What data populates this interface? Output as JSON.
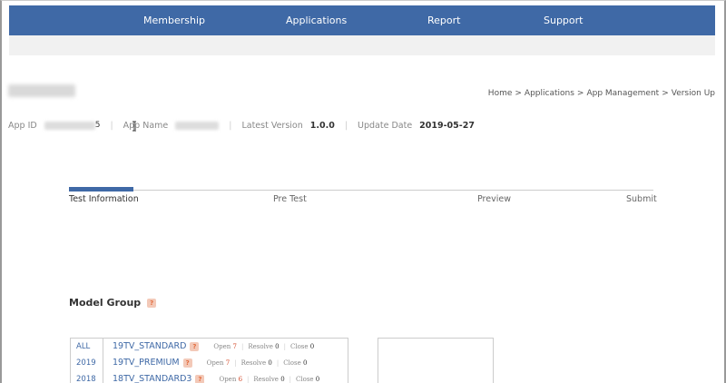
{
  "nav": {
    "items": [
      "Membership",
      "Applications",
      "Report",
      "Support"
    ]
  },
  "breadcrumb": {
    "items": [
      "Home",
      "Applications",
      "App Management",
      "Version Up"
    ],
    "separator": ">"
  },
  "info": {
    "app_id_label": "App ID",
    "app_id_suffix": "5",
    "app_name_label": "App Name",
    "latest_version_label": "Latest Version",
    "latest_version_value": "1.0.0",
    "update_date_label": "Update Date",
    "update_date_value": "2019-05-27",
    "divider": "|"
  },
  "steps": {
    "items": [
      "Test Information",
      "Pre Test",
      "Preview",
      "Submit"
    ],
    "active_index": 0
  },
  "model_group": {
    "title": "Model Group",
    "help": "?",
    "years": [
      "ALL",
      "2019",
      "2018"
    ],
    "rows": [
      {
        "name": "19TV_STANDARD",
        "open_label": "Open",
        "open": "7",
        "resolve_label": "Resolve",
        "resolve": "0",
        "close_label": "Close",
        "close": "0"
      },
      {
        "name": "19TV_PREMIUM",
        "open_label": "Open",
        "open": "7",
        "resolve_label": "Resolve",
        "resolve": "0",
        "close_label": "Close",
        "close": "0"
      },
      {
        "name": "18TV_STANDARD3",
        "open_label": "Open",
        "open": "6",
        "resolve_label": "Resolve",
        "resolve": "0",
        "close_label": "Close",
        "close": "0"
      }
    ],
    "stat_separator": "|"
  },
  "colors": {
    "nav_background": "#3f69a6",
    "accent": "#3f69a6",
    "help_badge": "#e26a3b"
  }
}
